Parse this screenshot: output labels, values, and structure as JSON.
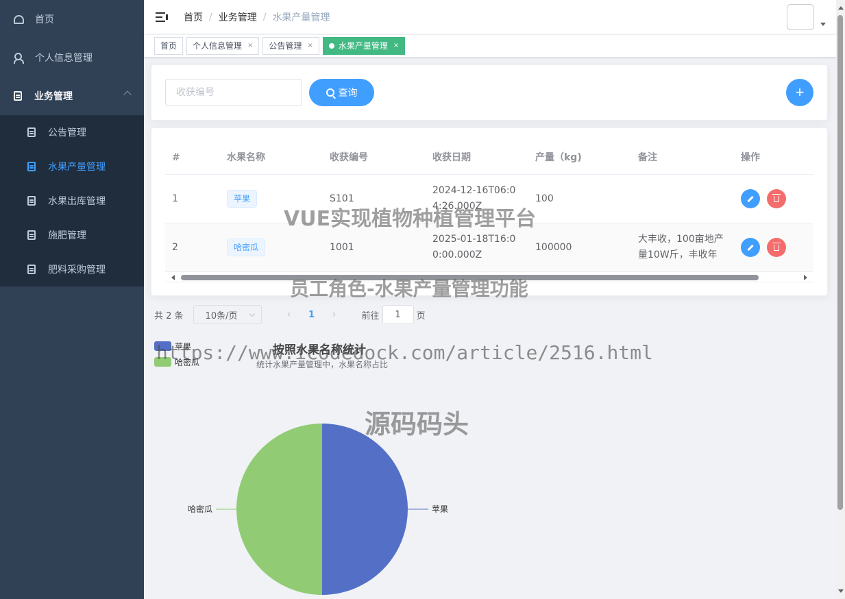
{
  "sidebar": {
    "items": [
      {
        "label": "首页",
        "icon": "dashboard-icon"
      },
      {
        "label": "个人信息管理",
        "icon": "user-icon"
      },
      {
        "label": "业务管理",
        "icon": "document-icon"
      }
    ],
    "sub_items": [
      {
        "label": "公告管理",
        "icon": "document-icon"
      },
      {
        "label": "水果产量管理",
        "icon": "document-icon"
      },
      {
        "label": "水果出库管理",
        "icon": "document-icon"
      },
      {
        "label": "施肥管理",
        "icon": "document-icon"
      },
      {
        "label": "肥料采购管理",
        "icon": "document-icon"
      }
    ]
  },
  "navbar": {
    "breadcrumb": [
      "首页",
      "业务管理",
      "水果产量管理"
    ],
    "separator": "/"
  },
  "tags": [
    {
      "label": "首页"
    },
    {
      "label": "个人信息管理",
      "close": "×"
    },
    {
      "label": "公告管理",
      "close": "×"
    },
    {
      "label": "水果产量管理",
      "close": "×"
    }
  ],
  "search": {
    "placeholder": "收获编号",
    "query_label": "查询",
    "add_label": "+"
  },
  "table": {
    "columns": [
      "#",
      "水果名称",
      "收获编号",
      "收获日期",
      "产量（kg)",
      "备注",
      "操作"
    ],
    "rows": [
      {
        "index": "1",
        "name": "苹果",
        "code": "S101",
        "date": "2024-12-16T06:04:26.000Z",
        "yield": "100",
        "remark": ""
      },
      {
        "index": "2",
        "name": "哈密瓜",
        "code": "1001",
        "date": "2025-01-18T16:00:00.000Z",
        "yield": "100000",
        "remark": "大丰收，100亩地产量10W斤，丰收年"
      }
    ]
  },
  "pagination": {
    "total": "共 2 条",
    "page_size": "10条/页",
    "prev": "‹",
    "current": "1",
    "next": "›",
    "goto_prefix": "前往",
    "goto_value": "1",
    "goto_suffix": "页"
  },
  "chart_data": {
    "type": "pie",
    "title": "按照水果名称统计",
    "subtitle": "统计水果产量管理中，水果名称占比",
    "legend_position": "top-left",
    "categories": [
      "苹果",
      "哈密瓜"
    ],
    "values": [
      1,
      1
    ],
    "colors": [
      "#5470c6",
      "#91cc75"
    ]
  },
  "watermarks": [
    "VUE实现植物种植管理平台",
    "员工角色-水果产量管理功能",
    "https://www.icodedock.com/article/2516.html",
    "源码码头"
  ],
  "colors": {
    "sidebar_bg": "#304156",
    "submenu_bg": "#1f2d3d",
    "primary": "#409eff",
    "active_tag": "#42b983",
    "danger": "#f56c6c"
  }
}
